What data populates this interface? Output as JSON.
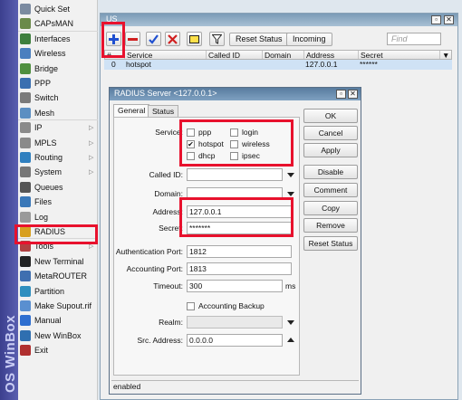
{
  "brand": {
    "text": "OS WinBox"
  },
  "sidebar": {
    "items": [
      {
        "label": "Quick Set",
        "icon": "quickset-icon",
        "color": "#7a8aa0",
        "submenu": false
      },
      {
        "label": "CAPsMAN",
        "icon": "antenna-icon",
        "color": "#6a8a4a",
        "submenu": false
      },
      {
        "label": "Interfaces",
        "icon": "interfaces-icon",
        "color": "#3e7f3e",
        "submenu": false
      },
      {
        "label": "Wireless",
        "icon": "wireless-icon",
        "color": "#4a7fbf",
        "submenu": false
      },
      {
        "label": "Bridge",
        "icon": "bridge-icon",
        "color": "#4f8f3f",
        "submenu": false
      },
      {
        "label": "PPP",
        "icon": "ppp-icon",
        "color": "#3a6fb0",
        "submenu": false
      },
      {
        "label": "Switch",
        "icon": "switch-icon",
        "color": "#7a7a7a",
        "submenu": false
      },
      {
        "label": "Mesh",
        "icon": "mesh-icon",
        "color": "#5c8fc2",
        "submenu": false
      },
      {
        "label": "IP",
        "icon": "ip-icon",
        "color": "#8a8a8a",
        "submenu": true
      },
      {
        "label": "MPLS",
        "icon": "mpls-icon",
        "color": "#8a8a8a",
        "submenu": true
      },
      {
        "label": "Routing",
        "icon": "routing-icon",
        "color": "#2f7fbf",
        "submenu": true
      },
      {
        "label": "System",
        "icon": "system-icon",
        "color": "#777777",
        "submenu": true
      },
      {
        "label": "Queues",
        "icon": "queues-icon",
        "color": "#555555",
        "submenu": false
      },
      {
        "label": "Files",
        "icon": "files-icon",
        "color": "#3a78b8",
        "submenu": false
      },
      {
        "label": "Log",
        "icon": "log-icon",
        "color": "#9a9a9a",
        "submenu": false
      },
      {
        "label": "RADIUS",
        "icon": "radius-icon",
        "color": "#d8a020",
        "submenu": false
      },
      {
        "label": "Tools",
        "icon": "tools-icon",
        "color": "#b04040",
        "submenu": true
      },
      {
        "label": "New Terminal",
        "icon": "terminal-icon",
        "color": "#222222",
        "submenu": false
      },
      {
        "label": "MetaROUTER",
        "icon": "metarouter-icon",
        "color": "#3f6fb0",
        "submenu": false
      },
      {
        "label": "Partition",
        "icon": "partition-icon",
        "color": "#2f8fbf",
        "submenu": false
      },
      {
        "label": "Make Supout.rif",
        "icon": "supout-icon",
        "color": "#5a8fd0",
        "submenu": false
      },
      {
        "label": "Manual",
        "icon": "manual-icon",
        "color": "#2f6fd0",
        "submenu": false
      },
      {
        "label": "New WinBox",
        "icon": "winbox-icon",
        "color": "#2f6fb0",
        "submenu": false
      },
      {
        "label": "Exit",
        "icon": "exit-icon",
        "color": "#b03030",
        "submenu": false
      }
    ]
  },
  "radius_window": {
    "title": "US",
    "find_placeholder": "Find",
    "toolbar": {
      "add_icon": "plus-icon",
      "remove_icon": "minus-icon",
      "enable_icon": "check-icon",
      "disable_icon": "cross-icon",
      "comment_icon": "comment-icon",
      "filter_icon": "filter-icon",
      "reset_status_label": "Reset Status",
      "incoming_label": "Incoming"
    },
    "table": {
      "columns": [
        "#",
        "Service",
        "Called ID",
        "Domain",
        "Address",
        "Secret"
      ],
      "rows": [
        {
          "num": "0",
          "service": "hotspot",
          "called_id": "",
          "domain": "",
          "address": "127.0.0.1",
          "secret": "******"
        }
      ]
    }
  },
  "dialog": {
    "title": "RADIUS Server <127.0.0.1>",
    "tabs": [
      "General",
      "Status"
    ],
    "service_label": "Service:",
    "services": [
      {
        "label": "ppp",
        "checked": false
      },
      {
        "label": "login",
        "checked": false
      },
      {
        "label": "hotspot",
        "checked": true
      },
      {
        "label": "wireless",
        "checked": false
      },
      {
        "label": "dhcp",
        "checked": false
      },
      {
        "label": "ipsec",
        "checked": false
      }
    ],
    "called_id_label": "Called ID:",
    "domain_label": "Domain:",
    "address_label": "Address:",
    "address_value": "127.0.0.1",
    "secret_label": "Secret:",
    "secret_value": "*******",
    "auth_port_label": "Authentication Port:",
    "auth_port_value": "1812",
    "acct_port_label": "Accounting Port:",
    "acct_port_value": "1813",
    "timeout_label": "Timeout:",
    "timeout_value": "300",
    "timeout_unit": "ms",
    "accounting_backup_label": "Accounting Backup",
    "realm_label": "Realm:",
    "src_address_label": "Src. Address:",
    "src_address_value": "0.0.0.0",
    "buttons": {
      "ok": "OK",
      "cancel": "Cancel",
      "apply": "Apply",
      "disable": "Disable",
      "comment": "Comment",
      "copy": "Copy",
      "remove": "Remove",
      "reset_status": "Reset Status"
    },
    "status_text": "enabled"
  },
  "colors": {
    "highlight": "#e8112d",
    "selected_row": "#cfe2f5",
    "titlebar": "#587c9f"
  }
}
